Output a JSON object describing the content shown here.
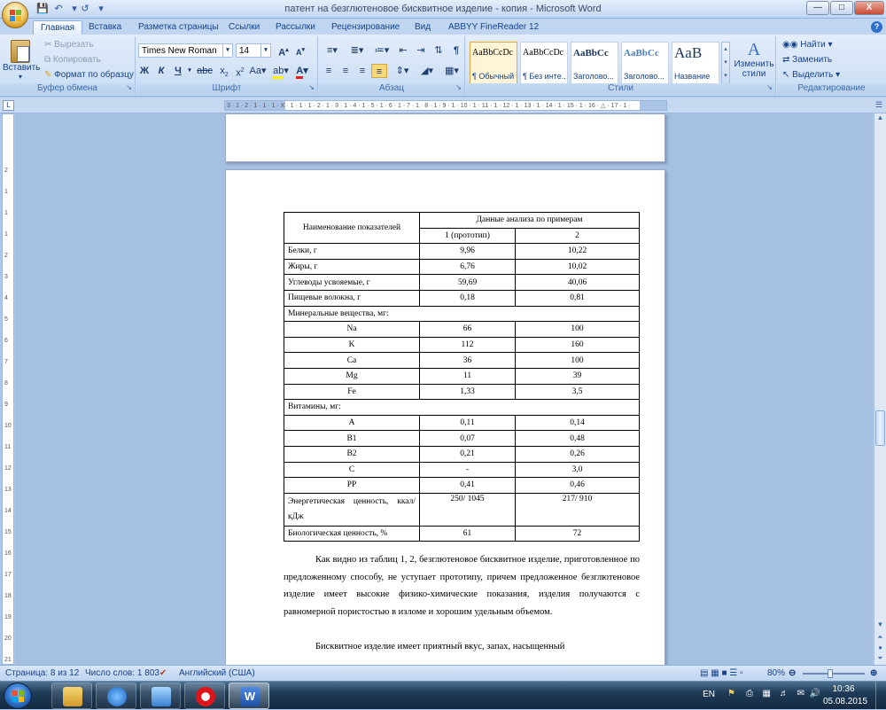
{
  "window": {
    "title": "патент на безглютеновое бисквитное изделие - копия - Microsoft Word"
  },
  "tabs": [
    "Главная",
    "Вставка",
    "Разметка страницы",
    "Ссылки",
    "Рассылки",
    "Рецензирование",
    "Вид",
    "ABBYY FineReader 12"
  ],
  "ribbon": {
    "clipboard": {
      "paste": "Вставить",
      "cut": "Вырезать",
      "copy": "Копировать",
      "format_painter": "Формат по образцу",
      "label": "Буфер обмена"
    },
    "font": {
      "name": "Times New Roman",
      "size": "14",
      "label": "Шрифт"
    },
    "paragraph": {
      "label": "Абзац"
    },
    "styles": {
      "items": [
        {
          "sample": "AaBbCcDc",
          "name": "¶ Обычный"
        },
        {
          "sample": "AaBbCcDc",
          "name": "¶ Без инте..."
        },
        {
          "sample": "AaBbCc",
          "name": "Заголово..."
        },
        {
          "sample": "AaBbCc",
          "name": "Заголово..."
        },
        {
          "sample": "AaB",
          "name": "Название"
        }
      ],
      "change": "Изменить стили",
      "label": "Стили"
    },
    "editing": {
      "find": "Найти",
      "replace": "Заменить",
      "select": "Выделить",
      "label": "Редактирование"
    }
  },
  "ruler": {
    "h_text": "3 · 1 · 2 · 1 · 1 · 1 · X · 1 · 1 · 1 · 2 · 1 · 3 · 1 · 4 · 1 · 5 · 1 · 6 · 1 · 7 · 1 · 8 · 1 · 9 · 1 · 10 · 1 · 11 · 1 · 12 · 1 · 13 · 1 · 14 · 1 · 15 · 1 · 16 · △ · 17 · 1 ·",
    "v_marks": [
      "2",
      "1",
      "1",
      "1",
      "2",
      "3",
      "4",
      "5",
      "6",
      "7",
      "8",
      "9",
      "10",
      "11",
      "12",
      "13",
      "14",
      "15",
      "16",
      "17",
      "18",
      "19",
      "20",
      "21"
    ]
  },
  "table": {
    "header": {
      "col1": "Наименование показателей",
      "group": "Данные анализа по примерам",
      "sub1": "1 (прототип)",
      "sub2": "2"
    },
    "rows": [
      {
        "kind": "row",
        "label": "Белки, г",
        "v1": "9,96",
        "v2": "10,22"
      },
      {
        "kind": "row",
        "label": "Жиры, г",
        "v1": "6,76",
        "v2": "10,02"
      },
      {
        "kind": "row",
        "label": "Углеводы усвояемые, г",
        "v1": "59,69",
        "v2": "40,06"
      },
      {
        "kind": "row",
        "label": "Пищевые волокна, г",
        "v1": "0,18",
        "v2": "0,81"
      },
      {
        "kind": "section",
        "label": "Минеральные вещества, мг:"
      },
      {
        "kind": "center",
        "label": "Na",
        "v1": "66",
        "v2": "100"
      },
      {
        "kind": "center",
        "label": "K",
        "v1": "112",
        "v2": "160"
      },
      {
        "kind": "center",
        "label": "Ca",
        "v1": "36",
        "v2": "100"
      },
      {
        "kind": "center",
        "label": "Mg",
        "v1": "11",
        "v2": "39"
      },
      {
        "kind": "center",
        "label": "Fe",
        "v1": "1,33",
        "v2": "3,5"
      },
      {
        "kind": "section",
        "label": "Витамины, мг:"
      },
      {
        "kind": "center",
        "label": "A",
        "v1": "0,11",
        "v2": "0,14"
      },
      {
        "kind": "center",
        "label": "B1",
        "v1": "0,07",
        "v2": "0,48"
      },
      {
        "kind": "center",
        "label": "B2",
        "v1": "0,21",
        "v2": "0,26"
      },
      {
        "kind": "center",
        "label": "C",
        "v1": "-",
        "v2": "3,0"
      },
      {
        "kind": "center",
        "label": "PP",
        "v1": "0,41",
        "v2": "0,46"
      },
      {
        "kind": "energy",
        "label": "Энергетическая ценность, ккал/кДж",
        "v1": "250/ 1045",
        "v2": "217/ 910"
      },
      {
        "kind": "row",
        "label": "Биологическая ценность, %",
        "v1": "61",
        "v2": "72"
      }
    ]
  },
  "body": {
    "p1": "Как видно из таблиц 1, 2, безглютеновое бисквитное изделие, приготовленное по предложенному способу, не уступает прототипу, причем предложенное безглютеновое изделие имеет высокие физико-химические показания, изделия получаются с равномерной пористостью в изломе и хорошим удельным объемом.",
    "p2": "Бисквитное изделие имеет приятный вкус, запах, насыщенный"
  },
  "status": {
    "page": "Страница: 8 из 12",
    "words": "Число слов: 1 803",
    "lang": "Английский (США)",
    "zoom": "80%"
  },
  "taskbar": {
    "lang": "EN",
    "time": "10:36",
    "date": "05.08.2015"
  }
}
